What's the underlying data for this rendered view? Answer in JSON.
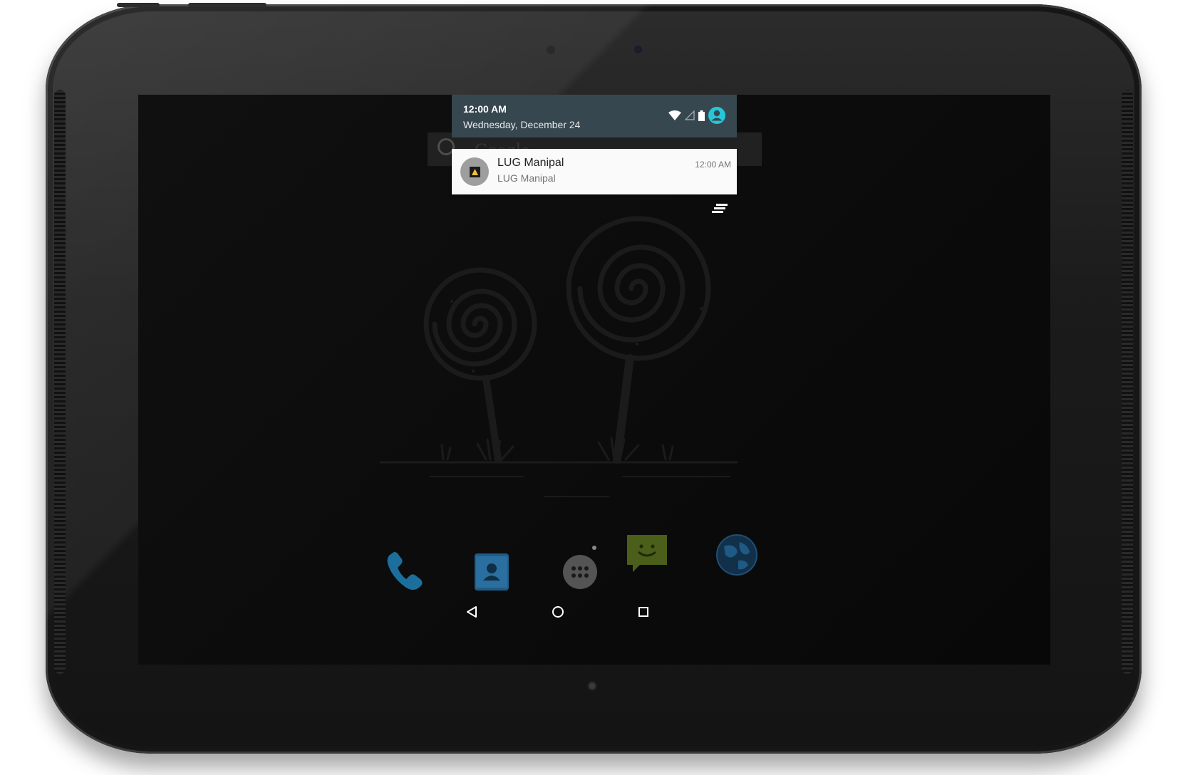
{
  "status_header": {
    "time": "12:00 AM",
    "date": "Wednesday, December 24"
  },
  "notification": {
    "title": "LUG Manipal",
    "text": "LUG Manipal",
    "time": "12:00 AM"
  },
  "search_bar": {
    "label": "Google"
  },
  "status_icons": [
    "wifi-icon",
    "cell-signal-icon",
    "battery-icon",
    "user-avatar-icon"
  ],
  "dock": {
    "apps": [
      {
        "name": "phone",
        "icon": "phone-icon"
      },
      {
        "name": "contacts",
        "icon": "contacts-icon"
      },
      {
        "name": "app-drawer",
        "icon": "app-drawer-icon"
      },
      {
        "name": "messaging",
        "icon": "messaging-icon"
      },
      {
        "name": "browser",
        "icon": "browser-globe-icon"
      }
    ]
  },
  "nav_bar": [
    "back-icon",
    "home-icon",
    "recents-icon"
  ],
  "colors": {
    "header_bg": "#37474f",
    "avatar_accent": "#26c6da",
    "notification_bg": "#fafafa",
    "phone_blue": "#1c6e9c",
    "messaging_green": "#4b5e1a"
  }
}
